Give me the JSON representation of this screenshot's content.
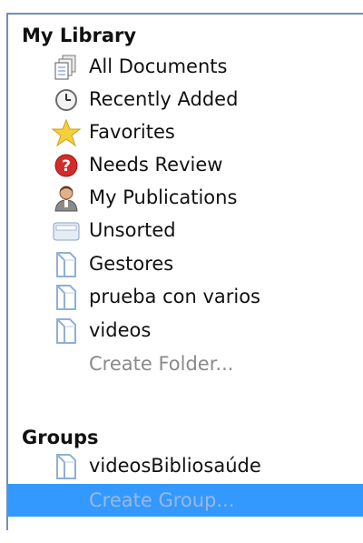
{
  "my_library": {
    "header": "My Library",
    "items": [
      {
        "label": "All Documents",
        "icon": "all-documents-icon"
      },
      {
        "label": "Recently Added",
        "icon": "clock-icon"
      },
      {
        "label": "Favorites",
        "icon": "star-icon"
      },
      {
        "label": "Needs Review",
        "icon": "question-icon"
      },
      {
        "label": "My Publications",
        "icon": "person-icon"
      },
      {
        "label": "Unsorted",
        "icon": "envelope-icon"
      },
      {
        "label": "Gestores",
        "icon": "folder-icon"
      },
      {
        "label": "prueba con varios",
        "icon": "folder-icon"
      },
      {
        "label": "videos",
        "icon": "folder-icon"
      }
    ],
    "create_folder": "Create Folder..."
  },
  "groups": {
    "header": "Groups",
    "items": [
      {
        "label": "videosBibliosaúde",
        "icon": "folder-icon"
      }
    ],
    "create_group": "Create Group..."
  },
  "colors": {
    "selection": "#3399ff",
    "border": "#6f8fb8",
    "dim_text": "#8a8a8a"
  }
}
